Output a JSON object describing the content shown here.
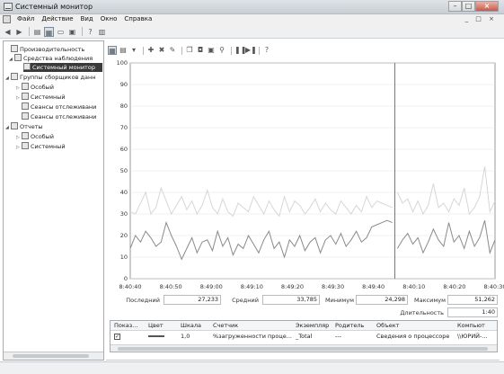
{
  "window": {
    "title": "Системный монитор"
  },
  "menu": [
    "Файл",
    "Действие",
    "Вид",
    "Окно",
    "Справка"
  ],
  "menu_right": "_ □ ×",
  "titlebar_buttons": {
    "minimize": "–",
    "maximize": "□",
    "close": "×"
  },
  "toolbar_icons": [
    "back-icon",
    "forward-icon",
    "up-icon",
    "console-tree-icon",
    "properties-icon",
    "export-icon",
    "help-icon",
    "show-hide-icon"
  ],
  "tree": [
    {
      "label": "Производительность",
      "level": 0,
      "toggle": "",
      "icon": "performance-icon"
    },
    {
      "label": "Средства наблюдения",
      "level": 1,
      "toggle": "◢",
      "icon": "monitoring-tools-icon"
    },
    {
      "label": "Системный монитор",
      "level": 2,
      "toggle": "",
      "icon": "system-monitor-icon",
      "selected": true
    },
    {
      "label": "Группы сборщиков данн",
      "level": 0,
      "toggle": "◢",
      "icon": "collector-sets-icon"
    },
    {
      "label": "Особый",
      "level": 1,
      "toggle": "▷",
      "icon": "folder-icon"
    },
    {
      "label": "Системный",
      "level": 1,
      "toggle": "▷",
      "icon": "folder-icon"
    },
    {
      "label": "Сеансы отслеживани",
      "level": 1,
      "toggle": "",
      "icon": "folder-icon"
    },
    {
      "label": "Сеансы отслеживани",
      "level": 1,
      "toggle": "",
      "icon": "folder-icon"
    },
    {
      "label": "Отчеты",
      "level": 0,
      "toggle": "◢",
      "icon": "reports-icon"
    },
    {
      "label": "Особый",
      "level": 1,
      "toggle": "▷",
      "icon": "folder-icon"
    },
    {
      "label": "Системный",
      "level": 1,
      "toggle": "▷",
      "icon": "folder-icon"
    }
  ],
  "graph_toolbar": [
    "view-current-activity-icon",
    "view-log-data-icon",
    "change-graph-type-icon",
    "add-counter-icon",
    "delete-counter-icon",
    "highlight-icon",
    "copy-properties-icon",
    "paste-counter-list-icon",
    "properties-icon",
    "zoom-icon",
    "freeze-display-icon",
    "update-data-icon",
    "help-icon"
  ],
  "chart_data": {
    "type": "line",
    "y_ticks": [
      "100",
      "90",
      "80",
      "70",
      "60",
      "50",
      "40",
      "30",
      "20",
      "10",
      "0"
    ],
    "ylim": [
      0,
      100
    ],
    "x_ticks": [
      "8:40:40",
      "8:40:50",
      "8:49:00",
      "8:49:10",
      "8:49:20",
      "8:49:30",
      "8:49:40",
      "8:40:10",
      "8:40:20",
      "8:40:30"
    ],
    "grid": true,
    "series": [
      {
        "color": "#8a8a8a",
        "values": [
          14,
          20,
          17,
          22,
          19,
          15,
          17,
          26,
          20,
          15,
          9,
          14,
          19,
          12,
          17,
          18,
          13,
          22,
          15,
          19,
          11,
          16,
          14,
          20,
          16,
          12,
          18,
          22,
          14,
          17,
          10,
          18,
          15,
          20,
          13,
          17,
          19,
          12,
          18,
          20,
          16,
          21,
          15,
          18,
          22,
          17,
          19,
          24,
          25,
          26,
          27,
          26,
          14,
          18,
          21,
          16,
          19,
          12,
          17,
          23,
          18,
          15,
          26,
          17,
          20,
          14,
          22,
          15,
          19,
          27,
          12,
          18
        ]
      },
      {
        "color": "#d6d6d6",
        "values": [
          31,
          30,
          35,
          40,
          30,
          33,
          42,
          36,
          30,
          34,
          38,
          32,
          36,
          30,
          34,
          41,
          33,
          30,
          37,
          31,
          29,
          35,
          33,
          31,
          38,
          34,
          30,
          36,
          32,
          29,
          38,
          31,
          36,
          34,
          30,
          33,
          37,
          31,
          35,
          32,
          30,
          36,
          33,
          30,
          34,
          31,
          38,
          33,
          36,
          35,
          34,
          33,
          40,
          35,
          37,
          31,
          36,
          30,
          34,
          44,
          33,
          35,
          31,
          37,
          34,
          42,
          30,
          33,
          38,
          52,
          31,
          36
        ]
      }
    ],
    "cursor_index": 51
  },
  "stats": {
    "last_label": "Последний",
    "last_value": "27,233",
    "avg_label": "Средний",
    "avg_value": "33,785",
    "min_label": "Минимум",
    "min_value": "24,298",
    "max_label": "Максимум",
    "max_value": "51,262",
    "duration_label": "Длительность",
    "duration_value": "1:40"
  },
  "counter_table": {
    "headers": [
      "Показ...",
      "Цвет",
      "Шкала",
      "Счетчик",
      "Экземпляр",
      "Родитель",
      "Объект",
      "Компьют"
    ],
    "rows": [
      {
        "show": "✓",
        "scale": "1,0",
        "counter": "%загруженности проце...",
        "instance": "_Total",
        "parent": "---",
        "object": "Сведения о процессоре",
        "computer": "\\\\ЮРИЙ-..."
      }
    ]
  }
}
